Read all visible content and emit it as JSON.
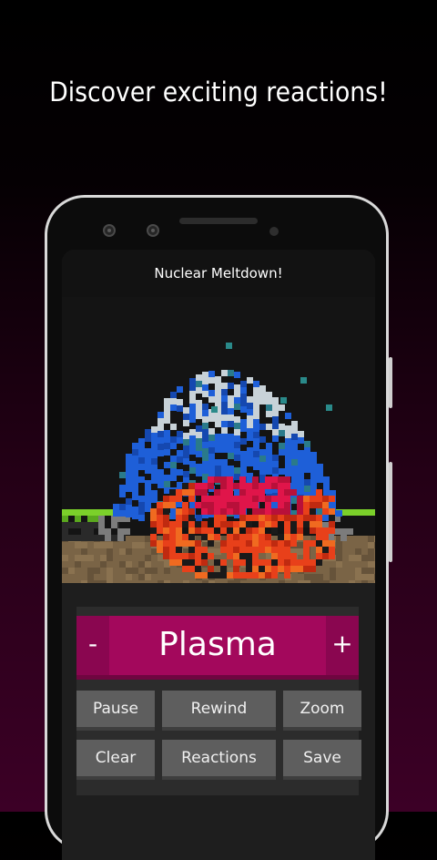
{
  "headline": "Discover exciting reactions!",
  "app": {
    "title": "Nuclear Meltdown!",
    "element_selector": {
      "minus_label": "-",
      "element_name": "Plasma",
      "plus_label": "+"
    },
    "buttons": {
      "pause": "Pause",
      "rewind": "Rewind",
      "zoom": "Zoom",
      "clear": "Clear",
      "reactions": "Reactions",
      "save": "Save"
    }
  },
  "colors": {
    "accent": "#a3085c",
    "water": "#1e5fd8",
    "ice": "#c8d2d8",
    "lava": "#e8401a",
    "plasma": "#e0154a",
    "ground": "#7a6446",
    "grass": "#7bd02a"
  }
}
